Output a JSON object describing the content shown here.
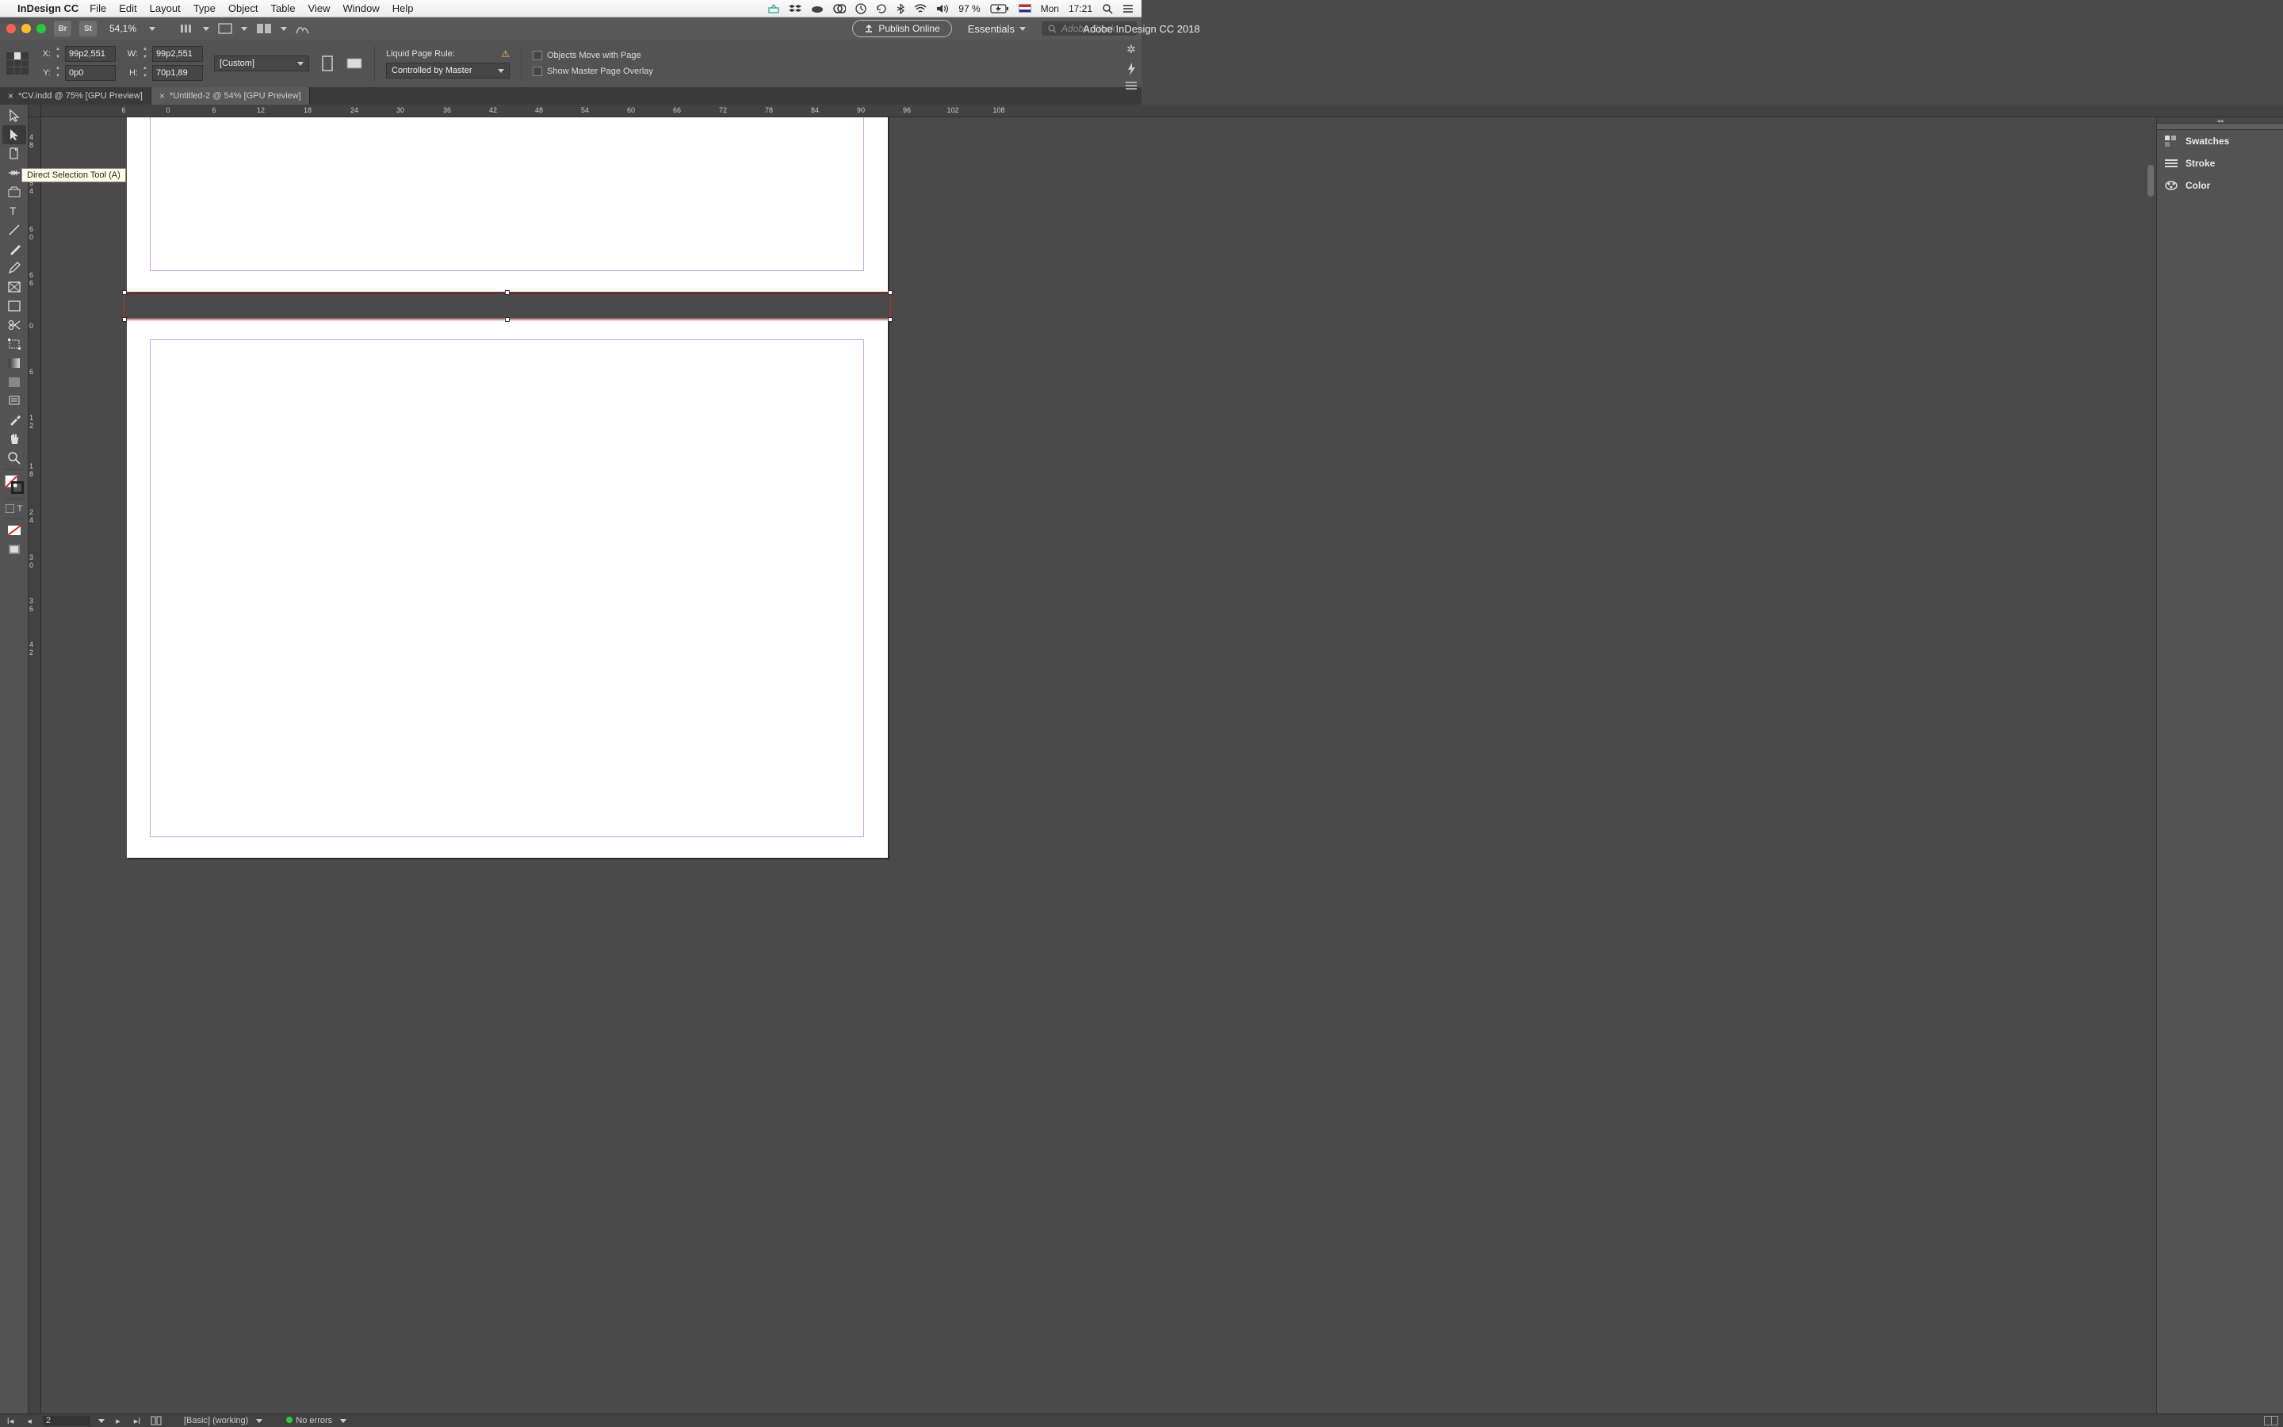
{
  "mac_menu": {
    "app_name": "InDesign CC",
    "items": [
      "File",
      "Edit",
      "Layout",
      "Type",
      "Object",
      "Table",
      "View",
      "Window",
      "Help"
    ],
    "battery": "97 %",
    "day": "Mon",
    "time": "17:21"
  },
  "window": {
    "title": "Adobe InDesign CC 2018",
    "zoom": "54,1%",
    "br_label": "Br",
    "st_label": "St",
    "publish_label": "Publish Online",
    "workspace": "Essentials",
    "stock_placeholder": "Adobe Stock"
  },
  "control": {
    "x_label": "X:",
    "x_value": "99p2,551",
    "y_label": "Y:",
    "y_value": "0p0",
    "w_label": "W:",
    "w_value": "99p2,551",
    "h_label": "H:",
    "h_value": "70p1,89",
    "preset": "[Custom]",
    "liquid_label": "Liquid Page Rule:",
    "liquid_value": "Controlled by Master",
    "chk_move": "Objects Move with Page",
    "chk_overlay": "Show Master Page Overlay"
  },
  "tabs": [
    {
      "label": "*CV.indd @ 75% [GPU Preview]",
      "active": false
    },
    {
      "label": "*Untitled-2 @ 54% [GPU Preview]",
      "active": true
    }
  ],
  "tooltip": "Direct Selection Tool (A)",
  "ruler_h": [
    {
      "v": "6",
      "px": 104
    },
    {
      "v": "0",
      "px": 160
    },
    {
      "v": "6",
      "px": 218
    },
    {
      "v": "12",
      "px": 277
    },
    {
      "v": "18",
      "px": 336
    },
    {
      "v": "24",
      "px": 395
    },
    {
      "v": "30",
      "px": 453
    },
    {
      "v": "36",
      "px": 512
    },
    {
      "v": "42",
      "px": 570
    },
    {
      "v": "48",
      "px": 628
    },
    {
      "v": "54",
      "px": 686
    },
    {
      "v": "60",
      "px": 744
    },
    {
      "v": "66",
      "px": 802
    },
    {
      "v": "72",
      "px": 860
    },
    {
      "v": "78",
      "px": 918
    },
    {
      "v": "84",
      "px": 976
    },
    {
      "v": "90",
      "px": 1034
    },
    {
      "v": "96",
      "px": 1092
    },
    {
      "v": "102",
      "px": 1150
    },
    {
      "v": "108",
      "px": 1208
    }
  ],
  "ruler_v": [
    {
      "v": "48",
      "px": 20
    },
    {
      "v": "54",
      "px": 78
    },
    {
      "v": "60",
      "px": 136
    },
    {
      "v": "66",
      "px": 194
    },
    {
      "v": "0",
      "px": 258
    },
    {
      "v": "6",
      "px": 316
    },
    {
      "v": "12",
      "px": 374
    },
    {
      "v": "18",
      "px": 435
    },
    {
      "v": "24",
      "px": 493
    },
    {
      "v": "30",
      "px": 550
    },
    {
      "v": "36",
      "px": 605
    },
    {
      "v": "42",
      "px": 660
    }
  ],
  "panels": {
    "swatches": "Swatches",
    "stroke": "Stroke",
    "color": "Color"
  },
  "status": {
    "page": "2",
    "preflight_profile": "[Basic] (working)",
    "errors": "No errors"
  }
}
